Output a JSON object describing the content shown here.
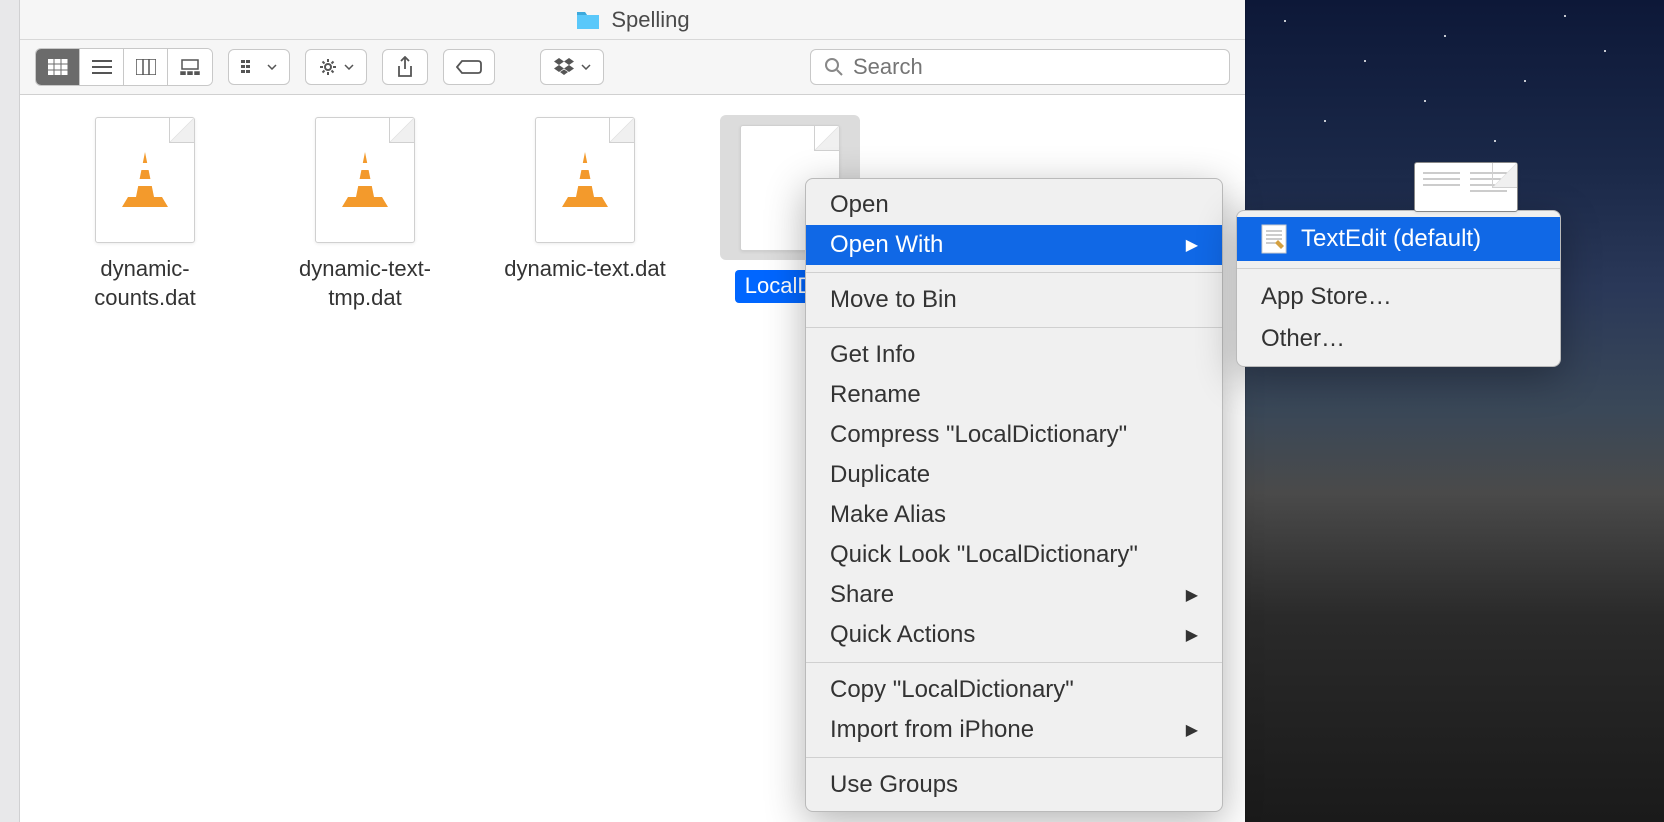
{
  "window": {
    "title": "Spelling"
  },
  "search": {
    "placeholder": "Search"
  },
  "files": [
    {
      "name": "dynamic-counts.dat",
      "icon": "vlc"
    },
    {
      "name": "dynamic-text-tmp.dat",
      "icon": "vlc"
    },
    {
      "name": "dynamic-text.dat",
      "icon": "vlc"
    },
    {
      "name": "LocalDictionary",
      "icon": "blank",
      "selected": true,
      "display": "LocalDict"
    }
  ],
  "contextMenu": {
    "items": [
      {
        "label": "Open",
        "type": "item"
      },
      {
        "label": "Open With",
        "type": "submenu",
        "highlighted": true
      },
      {
        "type": "divider"
      },
      {
        "label": "Move to Bin",
        "type": "item"
      },
      {
        "type": "divider"
      },
      {
        "label": "Get Info",
        "type": "item"
      },
      {
        "label": "Rename",
        "type": "item"
      },
      {
        "label": "Compress \"LocalDictionary\"",
        "type": "item"
      },
      {
        "label": "Duplicate",
        "type": "item"
      },
      {
        "label": "Make Alias",
        "type": "item"
      },
      {
        "label": "Quick Look \"LocalDictionary\"",
        "type": "item"
      },
      {
        "label": "Share",
        "type": "submenu"
      },
      {
        "label": "Quick Actions",
        "type": "submenu"
      },
      {
        "type": "divider"
      },
      {
        "label": "Copy \"LocalDictionary\"",
        "type": "item"
      },
      {
        "label": "Import from iPhone",
        "type": "submenu"
      },
      {
        "type": "divider"
      },
      {
        "label": "Use Groups",
        "type": "item"
      }
    ]
  },
  "submenu": {
    "items": [
      {
        "label": "TextEdit (default)",
        "highlighted": true,
        "icon": "textedit"
      },
      {
        "type": "divider"
      },
      {
        "label": "App Store…"
      },
      {
        "label": "Other…"
      }
    ]
  }
}
